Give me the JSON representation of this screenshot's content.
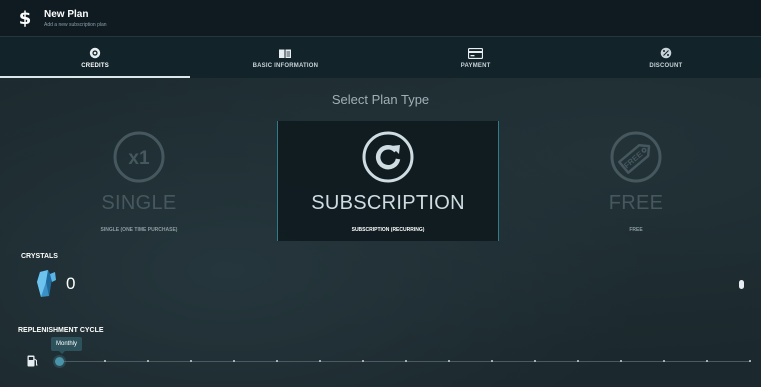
{
  "header": {
    "icon": "dollar-icon",
    "icon_glyph": "$",
    "title": "New Plan",
    "subtitle": "Add a new subscription plan"
  },
  "tabs": [
    {
      "label": "CREDITS",
      "icon": "credits-icon",
      "active": true
    },
    {
      "label": "BASIC INFORMATION",
      "icon": "book-icon",
      "active": false
    },
    {
      "label": "PAYMENT",
      "icon": "credit-card-icon",
      "active": false
    },
    {
      "label": "DISCOUNT",
      "icon": "discount-icon",
      "active": false
    }
  ],
  "plan_type": {
    "heading": "Select Plan Type",
    "selected": "subscription",
    "options": [
      {
        "id": "single",
        "icon": "x1-icon",
        "icon_text": "x1",
        "name": "SINGLE",
        "description": "SINGLE (ONE TIME PURCHASE)"
      },
      {
        "id": "subscription",
        "icon": "refresh-icon",
        "name": "SUBSCRIPTION",
        "description": "SUBSCRIPTION (RECURRING)"
      },
      {
        "id": "free",
        "icon": "free-tag-icon",
        "icon_text": "FREE",
        "name": "FREE",
        "description": "FREE"
      }
    ]
  },
  "crystals": {
    "label": "CRYSTALS",
    "icon": "crystal-icon",
    "value": "0"
  },
  "replenishment": {
    "label": "REPLENISHMENT CYCLE",
    "icon": "fuel-icon",
    "selected": "Monthly",
    "position": 0
  },
  "colors": {
    "accent": "#4a93a8",
    "selected_border": "#2f7d8c",
    "header_bg": "#0f1b20",
    "tab_bg": "#13232a"
  }
}
